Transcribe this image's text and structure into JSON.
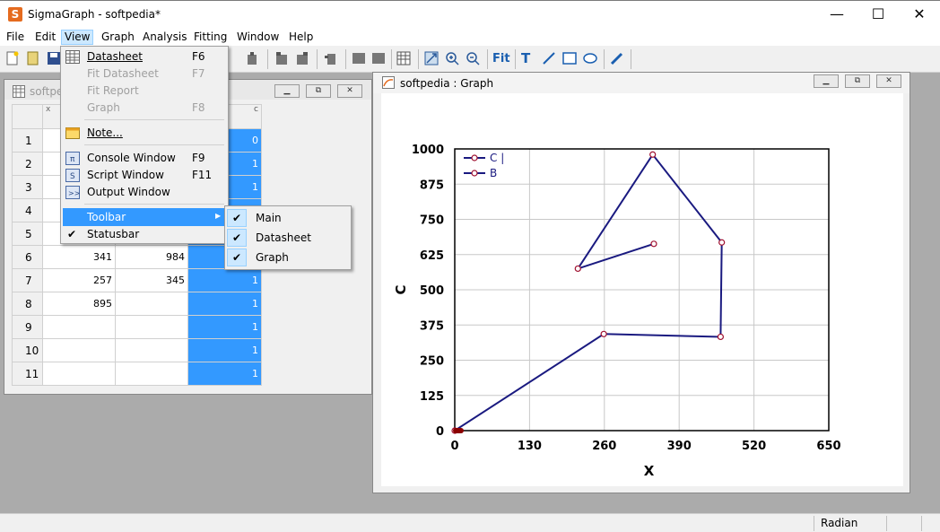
{
  "app": {
    "title": "SigmaGraph - softpedia*",
    "icon": "sigmagraph-app-icon"
  },
  "window_controls": {
    "minimize": "—",
    "maximize": "☐",
    "close": "✕"
  },
  "menubar": [
    "File",
    "Edit",
    "View",
    "Graph",
    "Analysis",
    "Fitting",
    "Window",
    "Help"
  ],
  "view_menu": {
    "items": [
      {
        "label": "Datasheet",
        "accel": "F6",
        "enabled": true
      },
      {
        "label": "Fit Datasheet",
        "accel": "F7",
        "enabled": false
      },
      {
        "label": "Fit Report",
        "accel": "",
        "enabled": false
      },
      {
        "label": "Graph",
        "accel": "F8",
        "enabled": false
      },
      {
        "label": "Note...",
        "accel": "",
        "enabled": true
      },
      {
        "label": "Console Window",
        "accel": "F9",
        "enabled": true
      },
      {
        "label": "Script Window",
        "accel": "F11",
        "enabled": true
      },
      {
        "label": "Output Window",
        "accel": "",
        "enabled": true
      },
      {
        "label": "Toolbar",
        "accel": "",
        "enabled": true
      },
      {
        "label": "Statusbar",
        "accel": "",
        "enabled": true
      }
    ],
    "statusbar_check": "✔",
    "submenu_arrow": "▶"
  },
  "toolbar_submenu": [
    {
      "label": "Main",
      "check": "✔"
    },
    {
      "label": "Datasheet",
      "check": "✔"
    },
    {
      "label": "Graph",
      "check": "✔"
    }
  ],
  "datasheet": {
    "title": "softpe",
    "col_x": "x",
    "col_c": "c",
    "rows": [
      {
        "n": "1",
        "x": "",
        "b": "",
        "c": "0"
      },
      {
        "n": "2",
        "x": "",
        "b": "",
        "c": "1"
      },
      {
        "n": "3",
        "x": "",
        "b": "",
        "c": "1"
      },
      {
        "n": "4",
        "x": "",
        "b": "",
        "c": "1"
      },
      {
        "n": "5",
        "x": "",
        "b": "",
        "c": "1"
      },
      {
        "n": "6",
        "x": "341",
        "b": "984",
        "c": "1"
      },
      {
        "n": "7",
        "x": "257",
        "b": "345",
        "c": "1"
      },
      {
        "n": "8",
        "x": "895",
        "b": "",
        "c": "1"
      },
      {
        "n": "9",
        "x": "",
        "b": "",
        "c": "1"
      },
      {
        "n": "10",
        "x": "",
        "b": "",
        "c": "1"
      },
      {
        "n": "11",
        "x": "",
        "b": "",
        "c": "1"
      }
    ]
  },
  "graph_window": {
    "title": "softpedia : Graph"
  },
  "chart_data": {
    "type": "line",
    "xlabel": "X",
    "ylabel": "C",
    "xlim": [
      0,
      650
    ],
    "ylim": [
      0,
      1000
    ],
    "xticks": [
      "0",
      "130",
      "260",
      "390",
      "520",
      "650"
    ],
    "yticks": [
      "0",
      "125",
      "250",
      "375",
      "500",
      "625",
      "750",
      "875",
      "1000"
    ],
    "legend": [
      "C |",
      "B"
    ],
    "legend_position": "top-left",
    "grid": true,
    "line_color": "#1a1a80",
    "marker_color": "#a01030",
    "series": [
      {
        "x": [
          346,
          214,
          344,
          464,
          462,
          259,
          0
        ],
        "y": [
          663,
          575,
          980,
          668,
          333,
          343,
          0
        ]
      }
    ]
  },
  "statusbar": {
    "mode": "Radian"
  }
}
